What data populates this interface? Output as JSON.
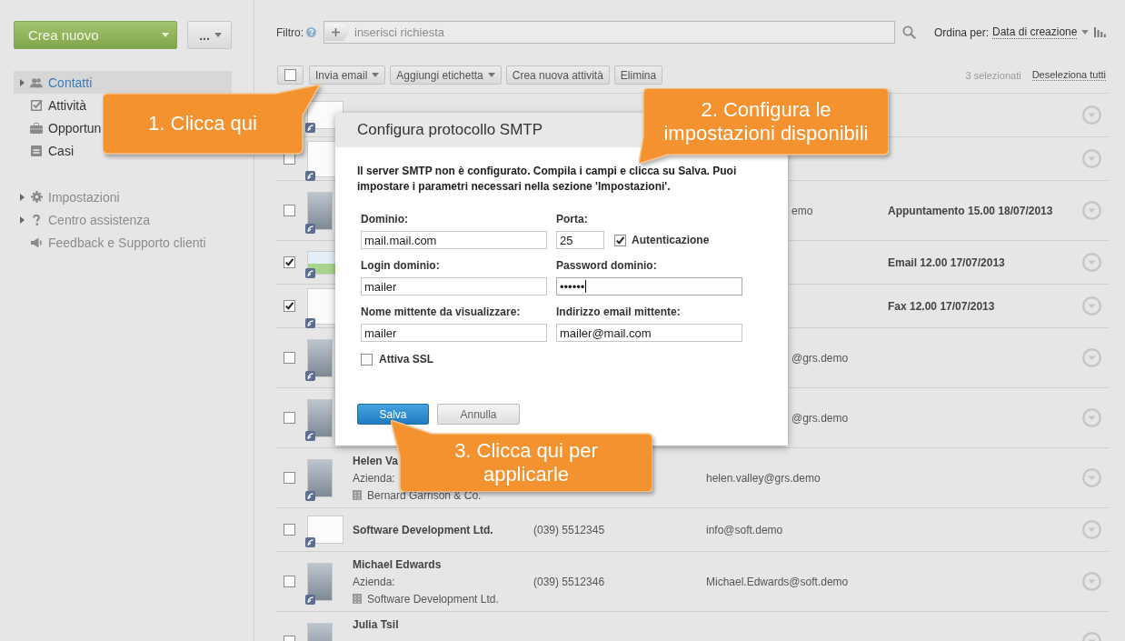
{
  "sidebar": {
    "create_button": "Crea nuovo",
    "more_button": "...",
    "nav": [
      {
        "label": "Contatti",
        "selected": true,
        "expandable": true
      },
      {
        "label": "Attività",
        "selected": false,
        "expandable": false
      },
      {
        "label": "Opportun",
        "selected": false,
        "expandable": false
      },
      {
        "label": "Casi",
        "selected": false,
        "expandable": false
      }
    ],
    "links": [
      {
        "label": "Impostazioni",
        "expandable": true
      },
      {
        "label": "Centro assistenza",
        "expandable": true
      },
      {
        "label": "Feedback e Supporto clienti",
        "expandable": false
      }
    ]
  },
  "filter": {
    "label": "Filtro:",
    "placeholder": "inserisci richiesta"
  },
  "sort": {
    "label": "Ordina per:",
    "value": "Data di creazione"
  },
  "toolbar": {
    "select_all": {
      "checked": false
    },
    "buttons": [
      {
        "label": "Invia email",
        "dropdown": true
      },
      {
        "label": "Aggiungi etichetta",
        "dropdown": true
      },
      {
        "label": "Crea nuova attività",
        "dropdown": false
      },
      {
        "label": "Elimina",
        "dropdown": false
      }
    ],
    "selection_count": "3 selezionati",
    "deselect_link": "Deseleziona tutti"
  },
  "rows": [
    {
      "kind": "behind_callout",
      "thumb": {
        "kind": "logo"
      }
    },
    {
      "kind": "behind_dialog",
      "selected": false,
      "thumb": {
        "kind": "logo"
      }
    },
    {
      "kind": "behind_dialog",
      "selected": false,
      "thumb": {
        "kind": "photo"
      },
      "email": "emo",
      "activity": "Appuntamento 15.00 18/07/2013"
    },
    {
      "kind": "behind_dialog",
      "selected": true,
      "thumb": {
        "kind": "picture"
      },
      "activity": "Email 12.00 17/07/2013"
    },
    {
      "kind": "behind_dialog",
      "selected": true,
      "thumb": {
        "kind": "logo"
      },
      "activity": "Fax 12.00 17/07/2013"
    },
    {
      "kind": "behind_dialog",
      "selected": false,
      "thumb": {
        "kind": "photo"
      },
      "email": "@grs.demo"
    },
    {
      "kind": "behind_dialog",
      "selected": false,
      "thumb": {
        "kind": "photo"
      },
      "email": "@grs.demo"
    },
    {
      "kind": "contact",
      "selected": false,
      "thumb": {
        "kind": "photo"
      },
      "name": "Helen Va",
      "company_label": "Azienda:",
      "company": "Bernard Garrison & Co.",
      "email": "helen.valley@grs.demo"
    },
    {
      "kind": "company",
      "selected": false,
      "thumb": {
        "kind": "logo"
      },
      "name": "Software Development Ltd.",
      "phone": "(039) 5512345",
      "email": "info@soft.demo"
    },
    {
      "kind": "contact",
      "selected": false,
      "thumb": {
        "kind": "photo"
      },
      "name": "Michael Edwards",
      "company_label": "Azienda:",
      "company": "Software Development Ltd.",
      "phone": "(039) 5512346",
      "email": "Michael.Edwards@soft.demo"
    },
    {
      "kind": "contact",
      "selected": false,
      "thumb": {
        "kind": "photo"
      },
      "name": "Julia Tsil"
    }
  ],
  "dialog": {
    "title": "Configura protocollo SMTP",
    "message": "Il server SMTP non è configurato. Compila i campi e clicca su Salva. Puoi impostare i parametri necessari nella sezione 'Impostazioni'.",
    "fields": [
      {
        "label": "Dominio:",
        "value": "mail.mail.com",
        "kind": "wide",
        "focused": false
      },
      {
        "label": "Porta:",
        "value": "25",
        "kind": "short",
        "focused": false
      },
      {
        "label": "Login dominio:",
        "value": "mailer",
        "kind": "wide",
        "focused": false
      },
      {
        "label": "Password dominio:",
        "value": "••••••",
        "kind": "wide",
        "focused": true
      },
      {
        "label": "Nome mittente da visualizzare:",
        "value": "mailer",
        "kind": "wide",
        "focused": false
      },
      {
        "label": "Indirizzo email mittente:",
        "value": "mailer@mail.com",
        "kind": "wide",
        "focused": false
      }
    ],
    "auth": {
      "label": "Autenticazione",
      "checked": true
    },
    "ssl": {
      "label": "Attiva SSL",
      "checked": false
    },
    "buttons": [
      {
        "label": "Salva",
        "kind": "primary"
      },
      {
        "label": "Annulla",
        "kind": "secondary"
      }
    ]
  },
  "callouts": [
    {
      "text": "1. Clicca qui"
    },
    {
      "text": "2. Configura le impostazioni disponibili"
    },
    {
      "text": "3. Clicca qui per applicarle"
    }
  ]
}
